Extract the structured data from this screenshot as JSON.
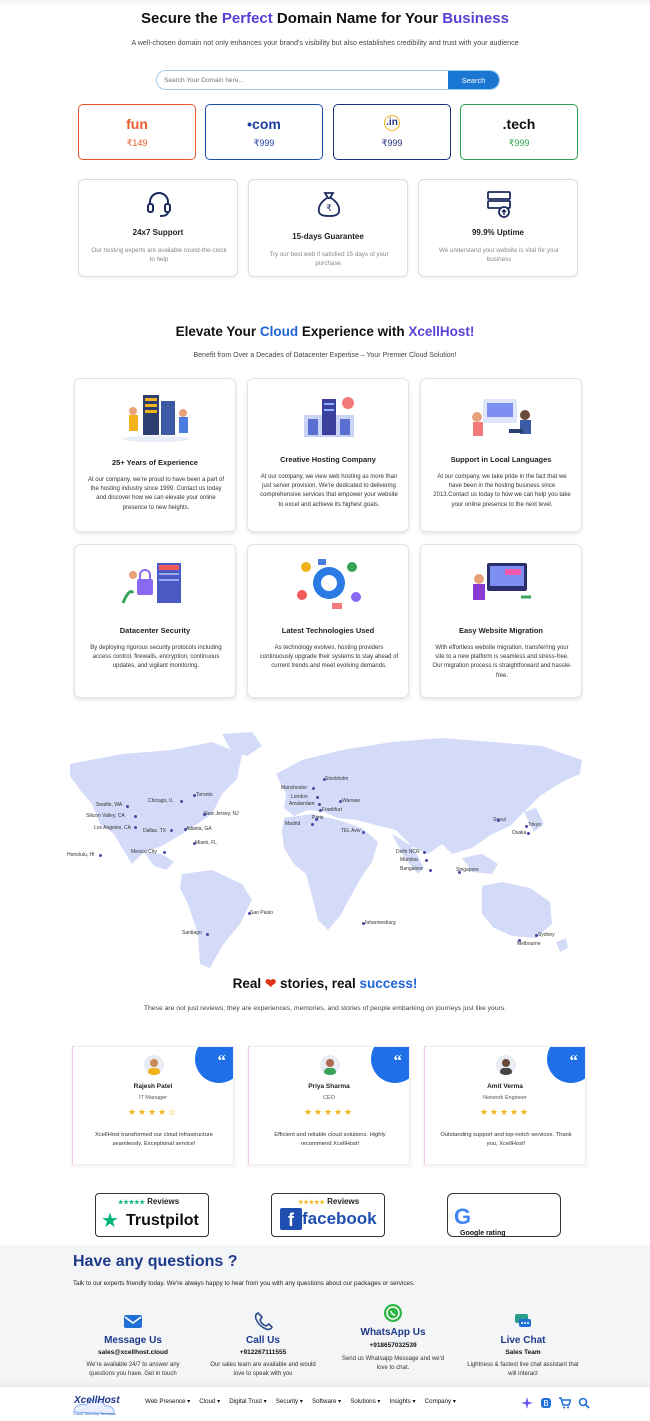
{
  "hero": {
    "title_a": "Secure the ",
    "title_b": "Perfect",
    "title_c": " Domain Name for Your ",
    "title_d": "Business",
    "subtitle": "A well-chosen domain not only enhances your brand's visibility but also establishes credibility and trust with your audience",
    "search_placeholder": "Search Your Domain here...",
    "search_button": "Search"
  },
  "tlds": [
    {
      "name": "fun",
      "price": "₹149",
      "color": "#e85b2b"
    },
    {
      "name": "•com",
      "price": "₹999",
      "color": "#1d3f9e"
    },
    {
      "name": ".in",
      "price": "₹999",
      "color": "#1d2f7e"
    },
    {
      "name": ".tech",
      "price": "₹999",
      "color": "#2aa14a"
    }
  ],
  "features": [
    {
      "title": "24x7 Support",
      "desc": "Our hosting experts are available round-the-clock to help",
      "icon": "headset-icon"
    },
    {
      "title": "15-days Guarantee",
      "desc": "Try our best web if satisfied 15 days of your purchase.",
      "icon": "money-bag-icon"
    },
    {
      "title": "99.9% Uptime",
      "desc": "We understand your website is vital for your business",
      "icon": "server-uptime-icon"
    }
  ],
  "elevate": {
    "title_a": "Elevate Your ",
    "title_b": "Cloud",
    "title_c": " Experience with ",
    "title_d": "XcellHost!",
    "subtitle": "Benefit from Over a Decades of Datacenter Expertise – Your Premier Cloud Solution!"
  },
  "cards": [
    {
      "title": "25+ Years of Experience",
      "desc": "At our company, we're proud to have been a part of the hosting industry since 1999. Contact us today and discover how we can elevate your online presence to new heights.",
      "icon": "team-servers-illustration-icon"
    },
    {
      "title": "Creative Hosting Company",
      "desc": "At our company, we view web hosting as more than just server provision. We're dedicated to delivering comprehensive services that empower your website to excel and achieve its highest goals.",
      "icon": "hosting-illustration-icon"
    },
    {
      "title": "Support in Local Languages",
      "desc": "At our company, we take pride in the fact that we have been in the hosting business since 2013.Contact us today to how we can help you take your online presence to the next level.",
      "icon": "support-illustration-icon"
    },
    {
      "title": "Datacenter Security",
      "desc": "By deploying rigorous security protocols including access control, firewalls, encryption, continuous updates, and vigilant monitoring.",
      "icon": "security-illustration-icon"
    },
    {
      "title": "Latest Technologies Used",
      "desc": "As technology evolves, hosting providers continuously upgrade their systems to stay ahead of current trends and meet evolving demands.",
      "icon": "technology-illustration-icon"
    },
    {
      "title": "Easy Website Migration",
      "desc": "With effortless website migration, transferring your site to a new platform is seamless and stress-free. Our migration process is straightforward and hassle-free.",
      "icon": "migration-illustration-icon"
    }
  ],
  "map_cities": [
    "Seattle, WA",
    "Silicon Valley, CA",
    "Los Angeles, CA",
    "Chicago, IL",
    "Toronto",
    "New Jersey, NJ",
    "Dallas, TX",
    "Atlanta, GA",
    "Miami, FL",
    "Mexico City",
    "Honolulu, HI",
    "Stockholm",
    "Manchester",
    "London",
    "Amsterdam",
    "Warsaw",
    "Frankfurt",
    "Paris",
    "Madrid",
    "TEL Aviv",
    "Delhi NCR",
    "Mumbai",
    "Bangalore",
    "Singapore",
    "Seoul",
    "Tokyo",
    "Osaka",
    "Sao Paulo",
    "Santiago",
    "Johannesburg",
    "Sydney",
    "Melbourne"
  ],
  "stories": {
    "title_a": "Real ",
    "title_b": "❤",
    "title_c": " stories, real ",
    "title_d": "success!",
    "subtitle": "These are not just reviews; they are experiences, memories, and stories of people embarking on journeys just like yours."
  },
  "reviews": [
    {
      "name": "Rajesh Patel",
      "role": "IT Manager",
      "stars": "★★★★☆",
      "text": "XcellHost transformed our cloud infrastructure seamlessly. Exceptional service!"
    },
    {
      "name": "Priya Sharma",
      "role": "CEO",
      "stars": "★★★★★",
      "text": "Efficient and reliable cloud solutions. Highly recommend XcellHost!"
    },
    {
      "name": "Amit Verma",
      "role": "Network Engineer",
      "stars": "★★★★★",
      "text": "Outstanding support and top-notch services. Thank you, XcellHost!"
    }
  ],
  "quote_mark": "“",
  "badges": {
    "trustpilot_top": "Reviews",
    "trustpilot": "Trustpilot",
    "facebook_top": "Reviews",
    "facebook": "facebook",
    "google": "Google rating",
    "trustpilot_stars": "★★★★★",
    "facebook_stars": "★★★★★"
  },
  "faq": {
    "title": "Have any questions ?",
    "subtitle": "Talk to our experts friendly today. We're always happy to hear from you with any questions about our packages or services."
  },
  "contacts": [
    {
      "title": "Message Us",
      "value": "sales@xcellhost.cloud",
      "desc": "We're available 24/7 to answer any questions you have. Get in touch",
      "icon": "email-icon"
    },
    {
      "title": "Call Us",
      "value": "+912267111555",
      "desc": "Our sales team are available and would love to speak with you",
      "icon": "phone-icon"
    },
    {
      "title": "WhatsApp Us",
      "value": "+918657032539",
      "desc": "Send us Whatsapp Message and we'd love to chat.",
      "icon": "whatsapp-icon"
    },
    {
      "title": "Live Chat",
      "value": "Sales Team",
      "desc": "Lightness & fastest live chat assistant that will interact",
      "icon": "chat-icon"
    }
  ],
  "nav": {
    "logo": "XcellHost",
    "logo_sub": "Cloud  Security  Services",
    "items": [
      "Web Presence ▾",
      "Cloud ▾",
      "Digital Trust ▾",
      "Security ▾",
      "Software ▾",
      "Solutions ▾",
      "Insights ▾",
      "Company ▾"
    ]
  },
  "colors": {
    "accent": "#1976d2",
    "brand": "#1e3a8a",
    "map": "#d3dbf8"
  }
}
